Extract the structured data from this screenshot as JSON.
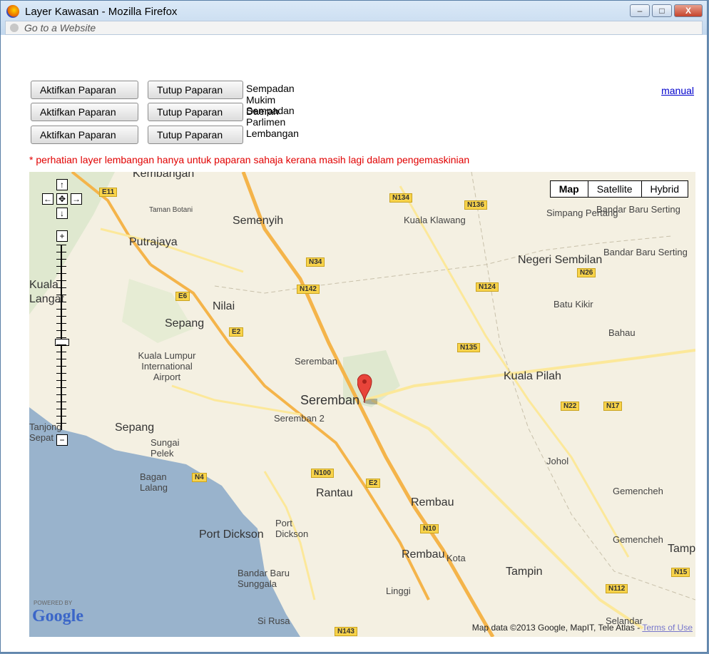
{
  "window": {
    "title": "Layer Kawasan - Mozilla Firefox",
    "url_placeholder": "Go to a Website",
    "controls": {
      "minimize": "–",
      "maximize": "□",
      "close": "X"
    }
  },
  "layers": [
    {
      "activate_label": "Aktifkan Paparan",
      "close_label": "Tutup Paparan",
      "name": "Sempadan Mukim Daerah"
    },
    {
      "activate_label": "Aktifkan Paparan",
      "close_label": "Tutup Paparan",
      "name": "Sempadan Parlimen"
    },
    {
      "activate_label": "Aktifkan Paparan",
      "close_label": "Tutup Paparan",
      "name": "Lembangan"
    }
  ],
  "manual_link": "manual",
  "notice": "* perhatian layer lembangan hanya untuk paparan sahaja kerana masih lagi dalam pengemaskinian",
  "map": {
    "type_controls": [
      "Map",
      "Satellite",
      "Hybrid"
    ],
    "selected_type": "Map",
    "nav": {
      "up": "↑",
      "left": "←",
      "center": "✥",
      "right": "→",
      "down": "↓",
      "zoom_in": "+",
      "zoom_out": "−"
    },
    "labels": [
      "Kembangan",
      "Semenyih",
      "Putrajaya",
      "Taman Botani",
      "Kuala Klawang",
      "Simpang Pertang",
      "Bandar Baru Serting",
      "Negeri Sembilan",
      "Bandar Baru Serting",
      "Batu Kikir",
      "Bahau",
      "Nilai",
      "Sepang",
      "Kuala Lumpur International Airport",
      "Seremban",
      "Seremban",
      "Seremban 2",
      "Kuala Pilah",
      "Sepang",
      "Sungai Pelek",
      "Johol",
      "Bagan Lalang",
      "Rantau",
      "Rembau",
      "Gemencheh",
      "Port Dickson",
      "Port Dickson",
      "Gemencheh",
      "Rembau",
      "Kota",
      "Tampin",
      "Bandar Baru Sunggala",
      "Linggi",
      "Si Rusa",
      "Selandar",
      "Kuala",
      "Langat",
      "Tanjong Sepat",
      "Tamp"
    ],
    "roads": [
      "E11",
      "N134",
      "N136",
      "N34",
      "N142",
      "E6",
      "N124",
      "N26",
      "E2",
      "N135",
      "N22",
      "N17",
      "N4",
      "N100",
      "E2",
      "N10",
      "N15",
      "N112",
      "N143"
    ],
    "powered_by": "POWERED BY",
    "google": "Google",
    "copyright": "Map data ©2013 Google, MapIT, Tele Atlas - ",
    "terms": "Terms of Use"
  },
  "colors": {
    "notice": "#e10000",
    "link": "#0000cc",
    "water": "#99b3cc",
    "road_major": "#f4b44a",
    "road_minor": "#fce89a",
    "land": "#f4f0e2"
  }
}
